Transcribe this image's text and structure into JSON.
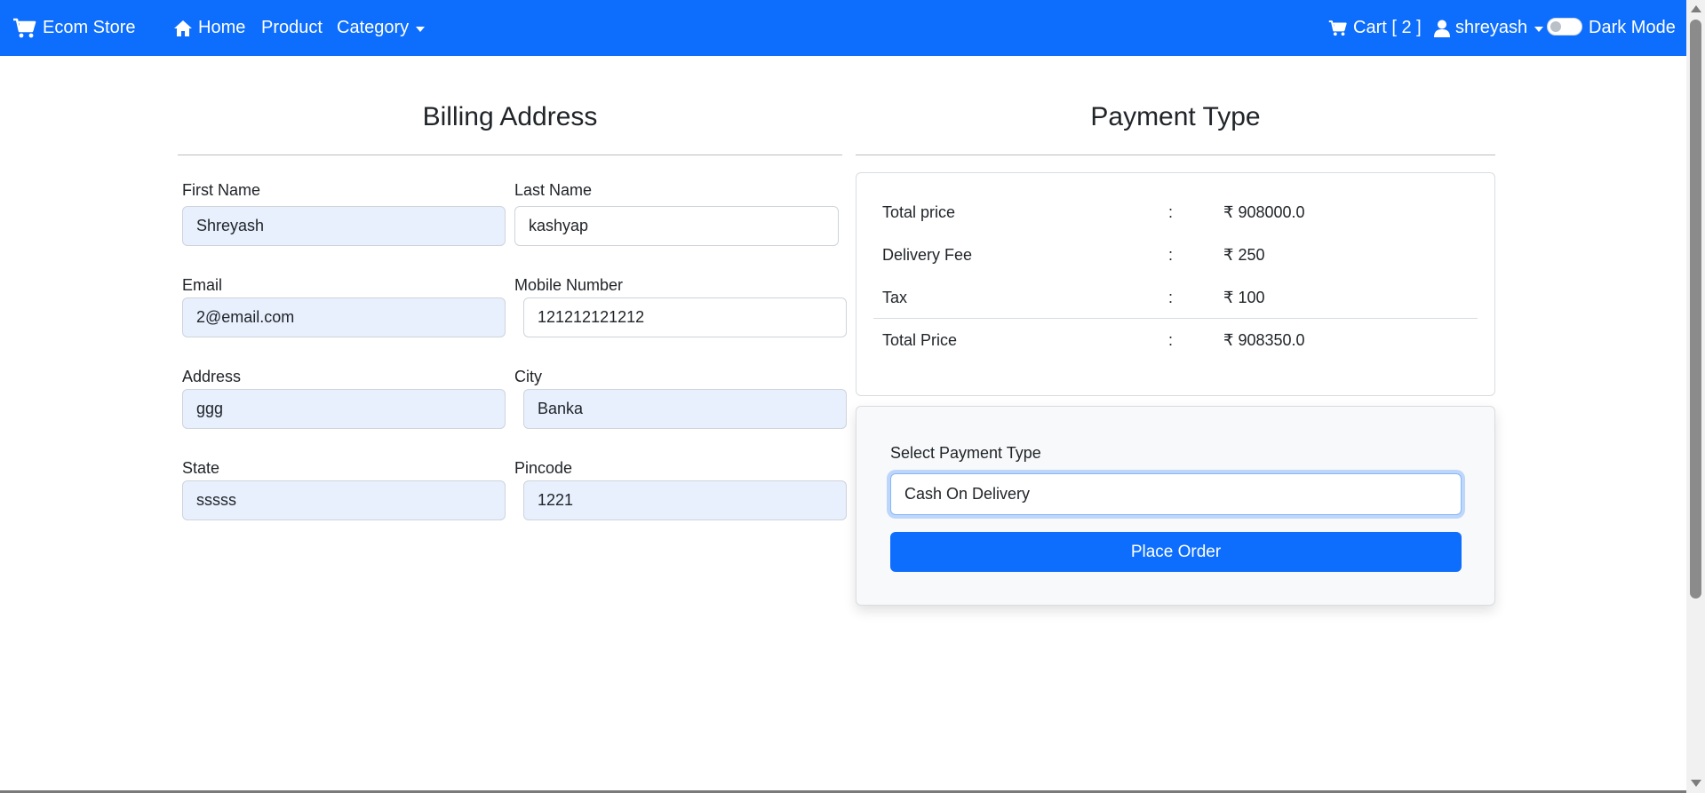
{
  "navbar": {
    "brand": "Ecom Store",
    "home": "Home",
    "product": "Product",
    "category": "Category",
    "cart": "Cart [ 2 ]",
    "user": "shreyash",
    "dark_mode": "Dark Mode",
    "dark_mode_on": false,
    "color": "#0d6efd"
  },
  "billing": {
    "title": "Billing Address",
    "first_name": {
      "label": "First Name",
      "value": "Shreyash"
    },
    "last_name": {
      "label": "Last Name",
      "value": "kashyap"
    },
    "email": {
      "label": "Email",
      "value": "2@email.com"
    },
    "mobile": {
      "label": "Mobile Number",
      "value": "121212121212"
    },
    "address": {
      "label": "Address",
      "value": "ggg"
    },
    "city": {
      "label": "City",
      "value": "Banka"
    },
    "state": {
      "label": "State",
      "value": "sssss"
    },
    "pincode": {
      "label": "Pincode",
      "value": "1221"
    }
  },
  "payment": {
    "title": "Payment Type",
    "summary": [
      {
        "label": "Total price",
        "sep": ":",
        "value": "₹ 908000.0"
      },
      {
        "label": "Delivery Fee",
        "sep": ":",
        "value": "₹ 250"
      },
      {
        "label": "Tax",
        "sep": ":",
        "value": "₹ 100"
      },
      {
        "label": "Total Price",
        "sep": ":",
        "value": "₹ 908350.0"
      }
    ],
    "select_label": "Select Payment Type",
    "selected": "Cash On Delivery",
    "place_order": "Place Order"
  }
}
